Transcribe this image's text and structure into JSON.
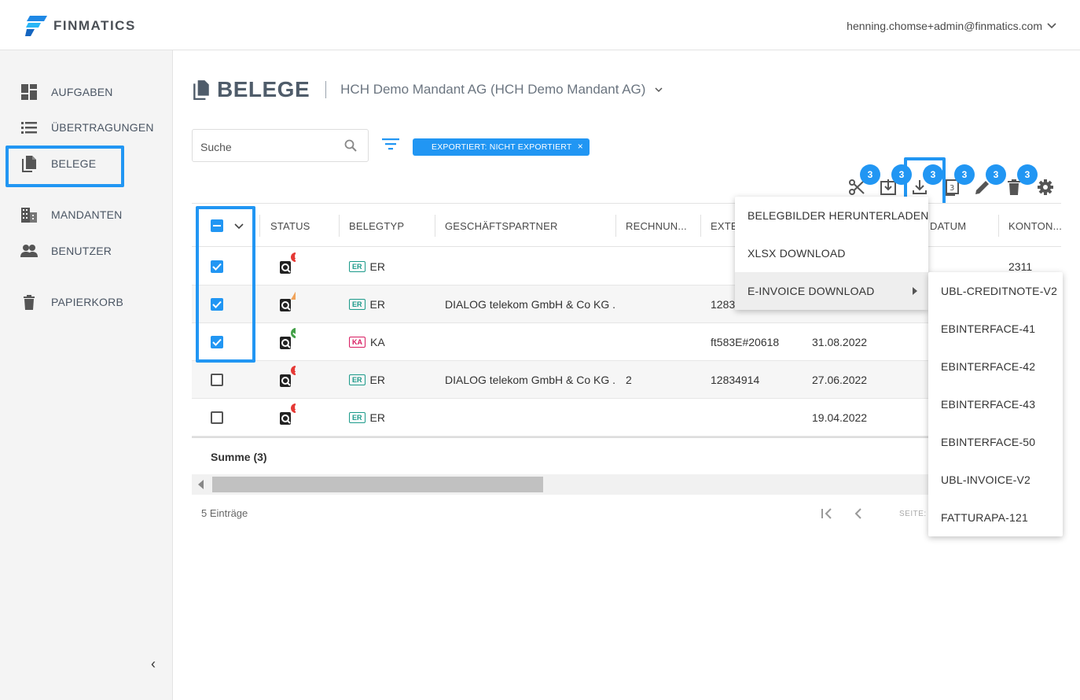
{
  "app": {
    "brand": "FINMATICS",
    "user_email": "henning.chomse+admin@finmatics.com"
  },
  "sidebar": {
    "items": [
      {
        "label": "AUFGABEN",
        "icon": "dashboard-icon"
      },
      {
        "label": "ÜBERTRAGUNGEN",
        "icon": "list-icon"
      },
      {
        "label": "BELEGE",
        "icon": "document-icon"
      },
      {
        "label": "MANDANTEN",
        "icon": "building-icon"
      },
      {
        "label": "BENUTZER",
        "icon": "people-icon"
      },
      {
        "label": "PAPIERKORB",
        "icon": "trash-icon"
      }
    ],
    "collapse_glyph": "‹"
  },
  "header": {
    "title": "BELEGE",
    "mandant": "HCH Demo Mandant AG (HCH Demo Mandant AG)"
  },
  "search": {
    "placeholder": "Suche"
  },
  "filter_chip": {
    "label": "EXPORTIERT: NICHT EXPORTIERT",
    "close": "×"
  },
  "toolbar": {
    "badges": [
      "3",
      "3",
      "3",
      "3",
      "3",
      "3"
    ],
    "icons": [
      "scissors-icon",
      "import-icon",
      "download-icon",
      "copy-icon",
      "edit-icon",
      "delete-icon",
      "settings-icon"
    ]
  },
  "table": {
    "columns": [
      "STATUS",
      "BELEGTYP",
      "GESCHÄFTSPARTNER",
      "RECHNUN...",
      "EXTE",
      "DATUM",
      "KONTON..."
    ],
    "rows": [
      {
        "checked": true,
        "status": "error",
        "type_code": "ER",
        "type": "ER",
        "partner": "",
        "rechnung": "",
        "extern": "",
        "datum": "",
        "konto": "2311"
      },
      {
        "checked": true,
        "status": "warning",
        "type_code": "ER",
        "type": "ER",
        "partner": "DIALOG telekom GmbH & Co KG ...",
        "rechnung": "",
        "extern": "1283",
        "datum": "",
        "konto": ""
      },
      {
        "checked": true,
        "status": "ok",
        "type_code": "KA",
        "type": "KA",
        "partner": "",
        "rechnung": "",
        "extern": "ft583E#20618",
        "datum": "31.08.2022",
        "konto": ""
      },
      {
        "checked": false,
        "status": "error",
        "type_code": "ER",
        "type": "ER",
        "partner": "DIALOG telekom GmbH & Co KG ...",
        "rechnung": "2",
        "extern": "12834914",
        "datum": "27.06.2022",
        "konto": ""
      },
      {
        "checked": false,
        "status": "error",
        "type_code": "ER",
        "type": "ER",
        "partner": "",
        "rechnung": "",
        "extern": "",
        "datum": "19.04.2022",
        "konto": ""
      }
    ],
    "summary": "Summe (3)",
    "entries": "5 Einträge",
    "page_label": "SEITE:"
  },
  "download_menu": {
    "items": [
      "BELEGBILDER HERUNTERLADEN",
      "XLSX DOWNLOAD",
      "E-INVOICE DOWNLOAD"
    ]
  },
  "einvoice_menu": {
    "items": [
      "UBL-CREDITNOTE-V2",
      "EBINTERFACE-41",
      "EBINTERFACE-42",
      "EBINTERFACE-43",
      "EBINTERFACE-50",
      "UBL-INVOICE-V2",
      "FATTURAPA-121"
    ]
  },
  "colors": {
    "accent": "#2196f3",
    "er": "#1b9a8a",
    "ka": "#d81b60",
    "error": "#e53935",
    "warning": "#f0a35a",
    "ok": "#43a047"
  }
}
